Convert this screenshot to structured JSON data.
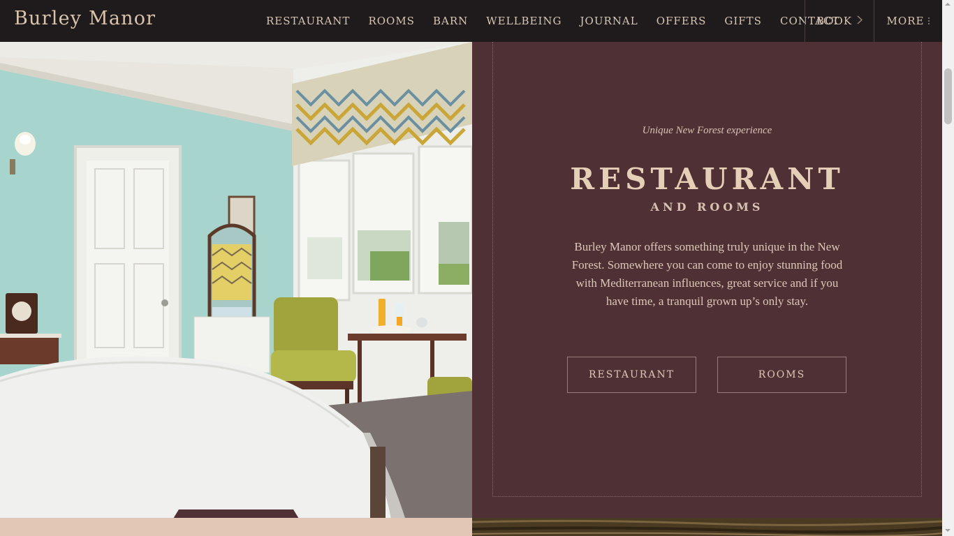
{
  "brand": {
    "name": "Burley Manor"
  },
  "nav": {
    "items": [
      {
        "label": "RESTAURANT"
      },
      {
        "label": "ROOMS"
      },
      {
        "label": "BARN"
      },
      {
        "label": "WELLBEING"
      },
      {
        "label": "JOURNAL"
      },
      {
        "label": "OFFERS"
      },
      {
        "label": "GIFTS"
      },
      {
        "label": "CONTACT"
      }
    ],
    "book_label": "BOOK",
    "more_label": "MORE"
  },
  "carousel": {
    "slide_count": 5,
    "active_index": 1
  },
  "hero": {
    "tagline": "Unique New Forest experience",
    "title": "RESTAURANT",
    "subtitle": "AND ROOMS",
    "description": "Burley Manor offers something truly unique in the New Forest. Somewhere you can come to enjoy stunning food with Mediterranean influences, great service and if you have time, a tranquil grown up’s only stay.",
    "buttons": [
      {
        "label": "RESTAURANT"
      },
      {
        "label": "ROOMS"
      }
    ]
  },
  "colors": {
    "nav_bg": "#1f1a1b",
    "panel_bg": "#4f3035",
    "accent_text": "#e6cfb7",
    "wall": "#a9d3cc"
  },
  "icons": {
    "book_chevron": "chevron-right-icon",
    "more_menu": "vertical-dots-icon",
    "carousel_dot": "diamond-icon"
  }
}
